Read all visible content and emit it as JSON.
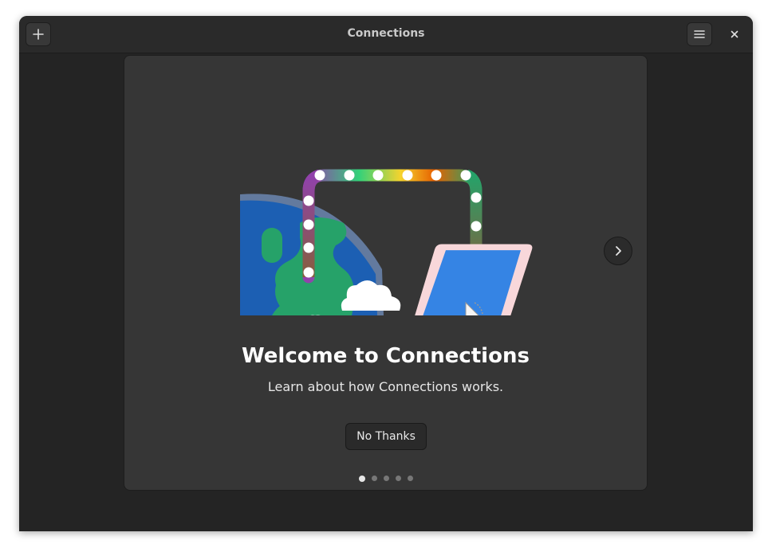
{
  "window": {
    "title": "Connections"
  },
  "headerbar": {
    "add_icon": "plus-icon",
    "menu_icon": "hamburger-menu-icon",
    "close_icon": "close-icon"
  },
  "welcome": {
    "heading": "Welcome to Connections",
    "subtitle": "Learn about how Connections works.",
    "dismiss_label": "No Thanks",
    "next_icon": "chevron-right-icon",
    "pages_total": 5,
    "current_page": 1
  },
  "colors": {
    "window_bg": "#242424",
    "headerbar_bg": "#2a2a2a",
    "card_bg": "#363636",
    "globe_ocean": "#1c5fb3",
    "globe_land": "#26a269",
    "laptop_screen": "#3584e4",
    "laptop_bezel": "#f8d7da"
  }
}
